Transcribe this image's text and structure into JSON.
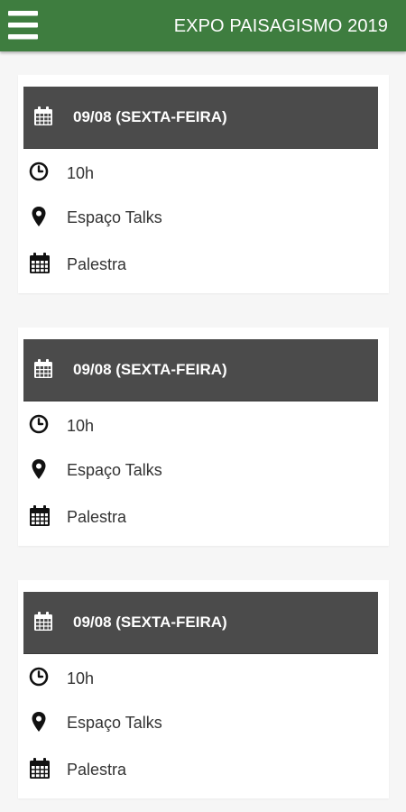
{
  "appbar": {
    "title": "EXPO PAISAGISMO 2019",
    "menu_icon": "hamburger-menu-icon",
    "background_color": "#3e7d3f"
  },
  "events": [
    {
      "date": "09/08 (SEXTA-FEIRA)",
      "date_icon": "calendar-icon",
      "time": "10h",
      "time_icon": "clock-icon",
      "location": "Espaço Talks",
      "location_icon": "map-pin-icon",
      "type": "Palestra",
      "type_icon": "calendar-icon"
    },
    {
      "date": "09/08 (SEXTA-FEIRA)",
      "date_icon": "calendar-icon",
      "time": "10h",
      "time_icon": "clock-icon",
      "location": "Espaço Talks",
      "location_icon": "map-pin-icon",
      "type": "Palestra",
      "type_icon": "calendar-icon"
    },
    {
      "date": "09/08 (SEXTA-FEIRA)",
      "date_icon": "calendar-icon",
      "time": "10h",
      "time_icon": "clock-icon",
      "location": "Espaço Talks",
      "location_icon": "map-pin-icon",
      "type": "Palestra",
      "type_icon": "calendar-icon"
    }
  ],
  "colors": {
    "card_header": "#4b4b4b",
    "page_background": "#f6f6f6",
    "text": "#333333"
  }
}
